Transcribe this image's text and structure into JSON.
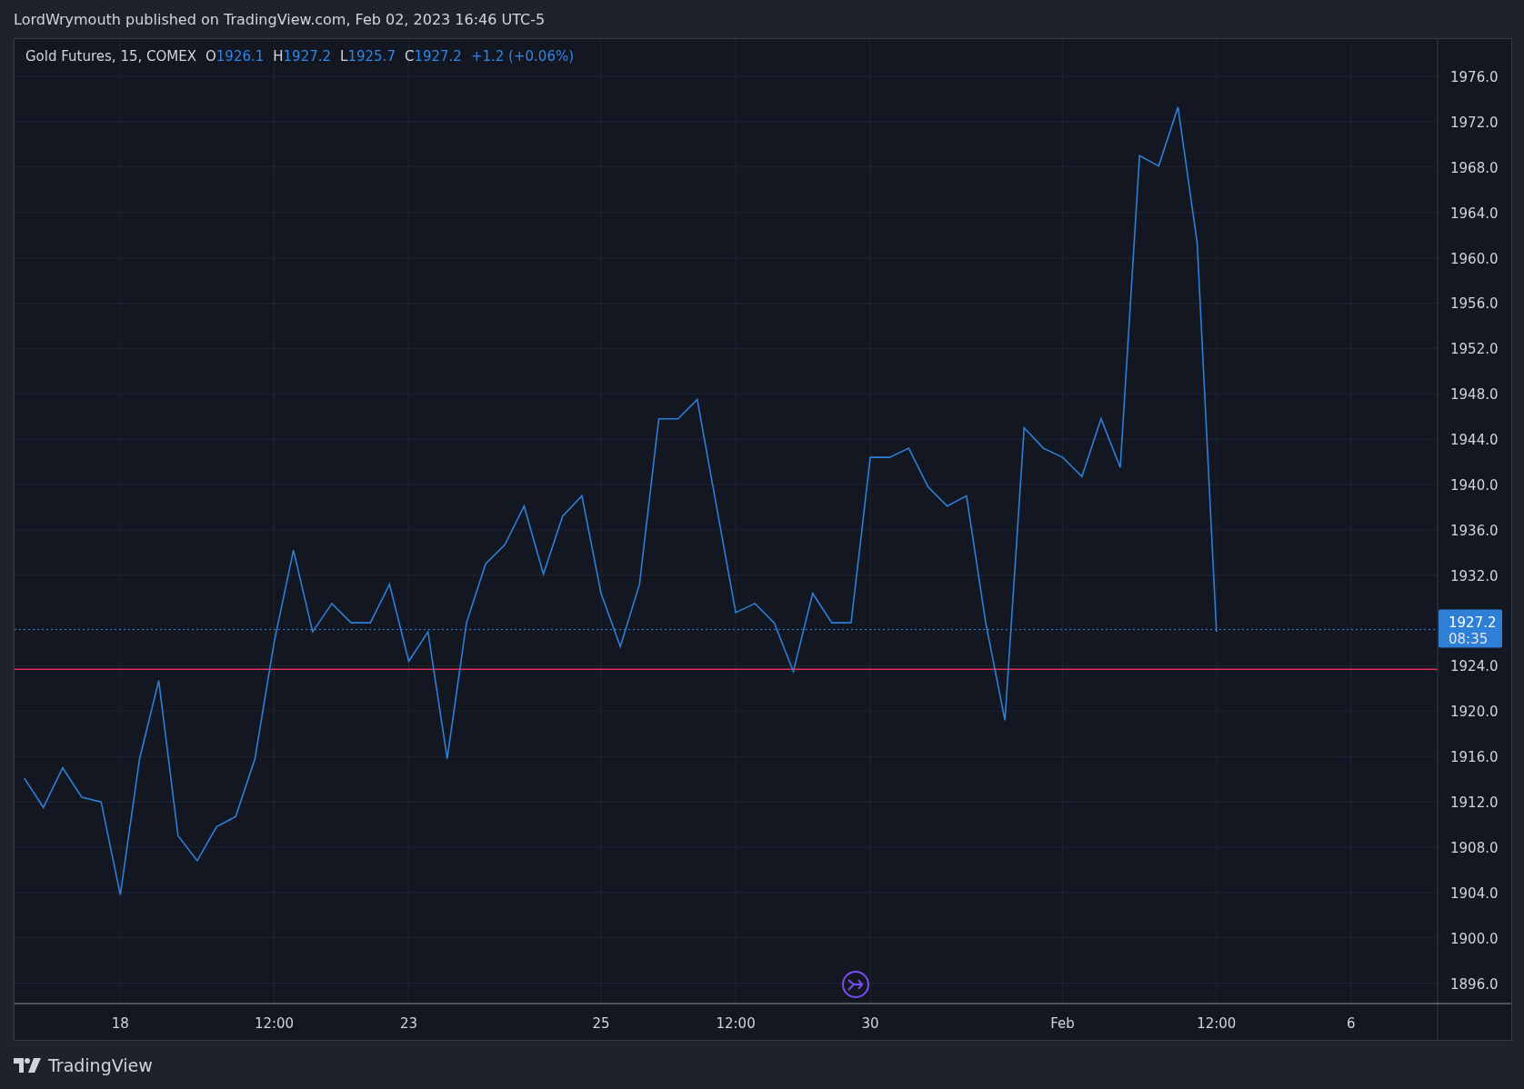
{
  "header": {
    "text": "LordWrymouth published on TradingView.com, Feb 02, 2023 16:46 UTC-5"
  },
  "legend": {
    "symbol": "Gold Futures, 15, COMEX",
    "ohlc": [
      {
        "key": "O",
        "value": "1926.1"
      },
      {
        "key": "H",
        "value": "1927.2"
      },
      {
        "key": "L",
        "value": "1925.7"
      },
      {
        "key": "C",
        "value": "1927.2"
      }
    ],
    "change": "+1.2 (+0.06%)"
  },
  "price_label": {
    "price": "1927.2",
    "countdown": "08:35"
  },
  "chart_data": {
    "type": "line",
    "categories": [
      null,
      null,
      null,
      null,
      null,
      "18",
      null,
      null,
      null,
      null,
      null,
      null,
      null,
      "12:00",
      null,
      null,
      null,
      null,
      null,
      null,
      "23",
      null,
      null,
      null,
      null,
      null,
      null,
      null,
      null,
      null,
      "25",
      null,
      null,
      null,
      null,
      null,
      null,
      "12:00",
      null,
      null,
      null,
      null,
      null,
      null,
      "30",
      null,
      null,
      null,
      null,
      null,
      null,
      null,
      null,
      null,
      "Feb",
      null,
      null,
      null,
      null,
      null,
      null,
      null,
      "12:00",
      null,
      null,
      null,
      null,
      null,
      null,
      "6",
      null,
      null,
      null,
      null
    ],
    "series": [
      {
        "color": "#2f7fd6",
        "values": [
          1914.1,
          1911.5,
          1915.0,
          1912.4,
          1912.0,
          1903.8,
          1915.8,
          1922.7,
          1909.0,
          1906.8,
          1909.8,
          1910.7,
          1915.8,
          1926.1,
          1934.2,
          1927.0,
          1929.5,
          1927.8,
          1927.8,
          1931.2,
          1924.4,
          1927.0,
          1915.8,
          1927.8,
          1933.0,
          1934.7,
          1938.1,
          1932.1,
          1937.2,
          1939.0,
          1930.4,
          1925.7,
          1931.2,
          1945.8,
          1945.8,
          1947.5,
          1938.1,
          1928.7,
          1929.5,
          1927.8,
          1923.5,
          1930.4,
          1927.8,
          1927.8,
          1942.4,
          1942.4,
          1943.2,
          1939.8,
          1938.1,
          1939.0,
          1927.8,
          1919.2,
          1945.0,
          1943.2,
          1942.4,
          1940.7,
          1945.8,
          1941.5,
          1969.0,
          1968.1,
          1973.3,
          1961.3,
          1927.0,
          null,
          null,
          null,
          null,
          null,
          null,
          null,
          null,
          null,
          null,
          null
        ]
      }
    ],
    "ylim": [
      1894.2,
      1979.3
    ],
    "yticks": [
      {
        "value": 1976,
        "label": "1976.0"
      },
      {
        "value": 1972,
        "label": "1972.0"
      },
      {
        "value": 1968,
        "label": "1968.0"
      },
      {
        "value": 1964,
        "label": "1964.0"
      },
      {
        "value": 1960,
        "label": "1960.0"
      },
      {
        "value": 1956,
        "label": "1956.0"
      },
      {
        "value": 1952,
        "label": "1952.0"
      },
      {
        "value": 1948,
        "label": "1948.0"
      },
      {
        "value": 1944,
        "label": "1944.0"
      },
      {
        "value": 1940,
        "label": "1940.0"
      },
      {
        "value": 1936,
        "label": "1936.0"
      },
      {
        "value": 1932,
        "label": "1932.0"
      },
      {
        "value": 1924,
        "label": "1924.0"
      },
      {
        "value": 1920,
        "label": "1920.0"
      },
      {
        "value": 1916,
        "label": "1916.0"
      },
      {
        "value": 1912,
        "label": "1912.0"
      },
      {
        "value": 1908,
        "label": "1908.0"
      },
      {
        "value": 1904,
        "label": "1904.0"
      },
      {
        "value": 1900,
        "label": "1900.0"
      },
      {
        "value": 1896,
        "label": "1896.0"
      }
    ],
    "grid": true,
    "ref_lines": [
      {
        "axis": "y",
        "value": 1923.7,
        "color": "#e0315a"
      },
      {
        "axis": "y",
        "value": 1927.2,
        "color": "#2f86e6"
      }
    ]
  },
  "footer": {
    "brand": "TradingView"
  }
}
